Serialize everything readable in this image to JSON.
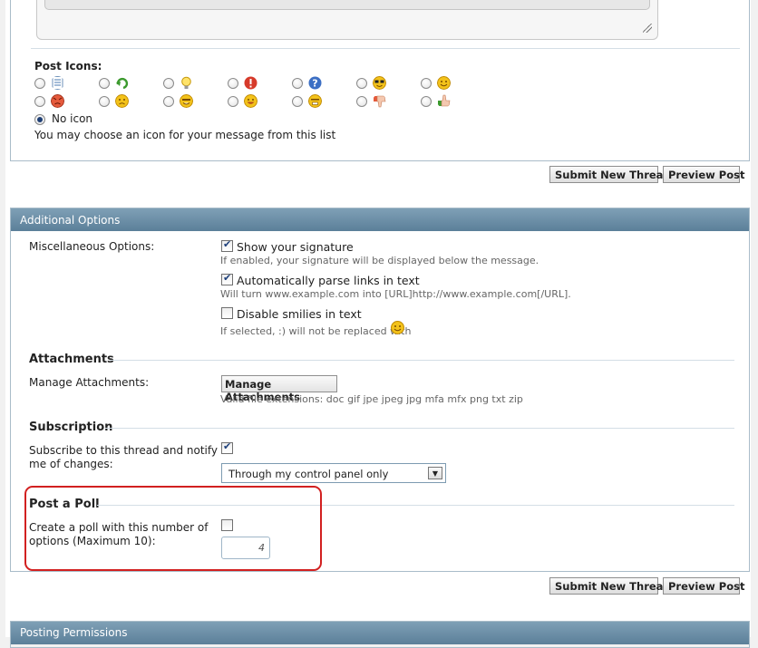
{
  "post_icons": {
    "title": "Post Icons:",
    "no_icon_label": "No icon",
    "help_text": "You may choose an icon for your message from this list",
    "icons": [
      "document-icon",
      "arrow-icon",
      "lightbulb-icon",
      "exclamation-icon",
      "question-icon",
      "cool-icon",
      "smile-icon",
      "angry-icon",
      "frown-icon",
      "redface-icon",
      "big-grin-icon",
      "embarrassed-icon",
      "thumbs-down-icon",
      "thumbs-up-icon"
    ],
    "selected": "No icon"
  },
  "buttons": {
    "submit": "Submit New Thread",
    "preview": "Preview Post"
  },
  "additional_options": {
    "title": "Additional Options",
    "misc_label": "Miscellaneous Options:",
    "show_signature": {
      "label": "Show your signature",
      "checked": true,
      "desc": "If enabled, your signature will be displayed below the message."
    },
    "parse_links": {
      "label": "Automatically parse links in text",
      "checked": true,
      "desc": "Will turn www.example.com into [URL]http://www.example.com[/URL]."
    },
    "disable_smilies": {
      "label": "Disable smilies in text",
      "checked": false,
      "desc": "If selected, :) will not be replaced with"
    }
  },
  "attachments": {
    "title": "Attachments",
    "label": "Manage Attachments:",
    "button": "Manage Attachments",
    "valid_ext": "Valid file extensions: doc gif jpe jpeg jpg mfa mfx png txt zip"
  },
  "subscription": {
    "title": "Subscription",
    "label_line1": "Subscribe to this thread and notify",
    "label_line2": "me of changes:",
    "checked": true,
    "select_value": "Through my control panel only"
  },
  "poll": {
    "title": "Post a Poll",
    "label_line1": "Create a poll with this number of",
    "label_line2": "options (Maximum 10):",
    "checked": false,
    "value": "4"
  },
  "posting_permissions": {
    "title": "Posting Permissions"
  },
  "colors": {
    "panel_header": "#6d91aa",
    "highlight": "#d22020",
    "smilie_yellow": "#f3c21a"
  }
}
